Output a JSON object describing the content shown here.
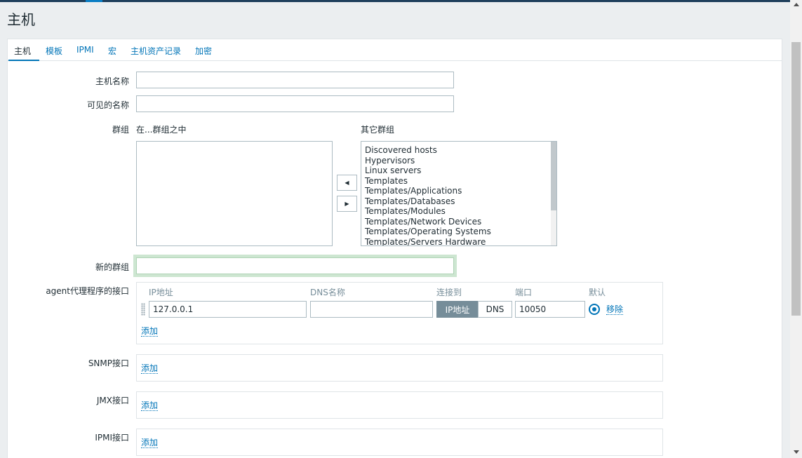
{
  "page": {
    "title": "主机"
  },
  "tabs": [
    {
      "label": "主机",
      "active": true
    },
    {
      "label": "模板"
    },
    {
      "label": "IPMI"
    },
    {
      "label": "宏"
    },
    {
      "label": "主机资产记录"
    },
    {
      "label": "加密"
    }
  ],
  "form": {
    "host_name_label": "主机名称",
    "host_name_value": "",
    "visible_name_label": "可见的名称",
    "visible_name_value": "",
    "groups_label": "群组",
    "in_groups_header": "在...群组之中",
    "other_groups_header": "其它群组",
    "in_groups": [],
    "other_groups": [
      "Discovered hosts",
      "Hypervisors",
      "Linux servers",
      "Templates",
      "Templates/Applications",
      "Templates/Databases",
      "Templates/Modules",
      "Templates/Network Devices",
      "Templates/Operating Systems",
      "Templates/Servers Hardware"
    ],
    "move_left_glyph": "◀",
    "move_right_glyph": "▶",
    "new_group_label": "新的群组",
    "new_group_value": ""
  },
  "agent": {
    "label": "agent代理程序的接口",
    "col_ip": "IP地址",
    "col_dns": "DNS名称",
    "col_connect": "连接到",
    "col_port": "端口",
    "col_default": "默认",
    "ip_value": "127.0.0.1",
    "dns_value": "",
    "connect_ip": "IP地址",
    "connect_dns": "DNS",
    "connect_selected": "IP地址",
    "port_value": "10050",
    "default_selected": true,
    "remove_link": "移除",
    "add_link": "添加"
  },
  "snmp": {
    "label": "SNMP接口",
    "add_link": "添加"
  },
  "jmx": {
    "label": "JMX接口",
    "add_link": "添加"
  },
  "ipmi": {
    "label": "IPMI接口",
    "add_link": "添加"
  },
  "colors": {
    "accent": "#0275b8",
    "header": "#1f3f5c",
    "selected_segment": "#768d99",
    "focus_ring": "#cde6d1"
  }
}
